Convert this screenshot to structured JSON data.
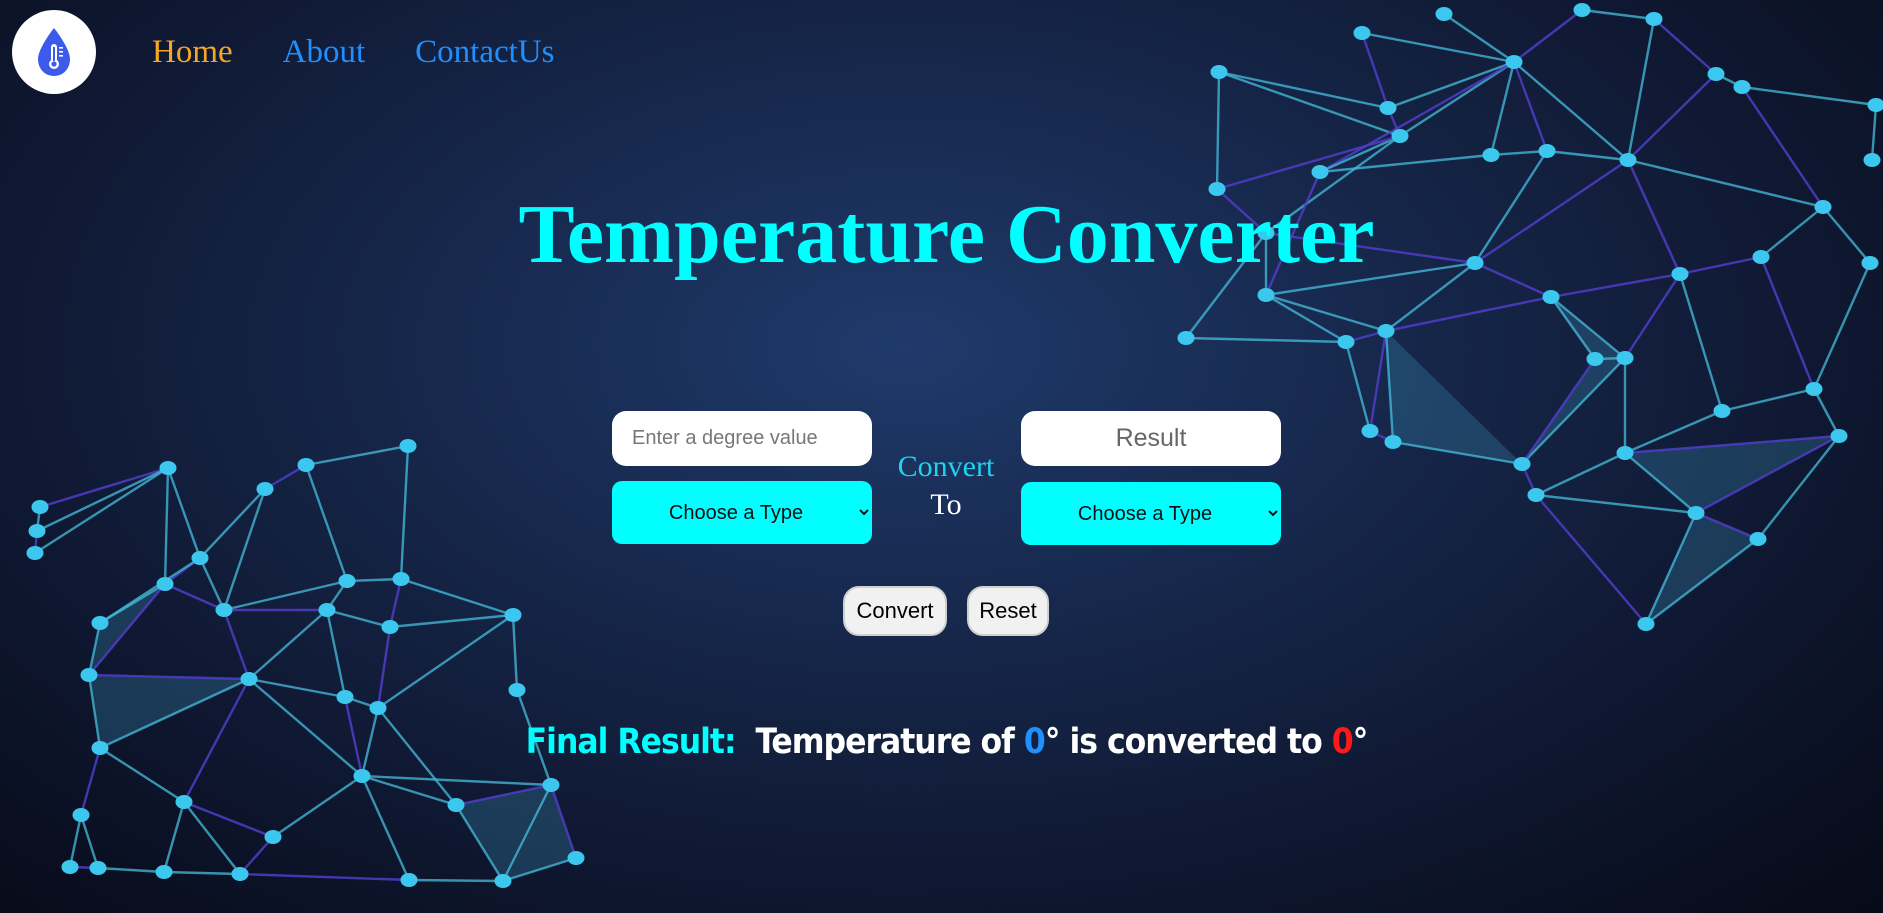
{
  "nav": {
    "links": [
      {
        "label": "Home",
        "active": true
      },
      {
        "label": "About",
        "active": false
      },
      {
        "label": "ContactUs",
        "active": false
      }
    ]
  },
  "title": "Temperature Converter",
  "converter": {
    "input_placeholder": "Enter a degree value",
    "input_value": "",
    "result_placeholder": "Result",
    "result_value": "",
    "from_select_value": "Choose a Type",
    "to_select_value": "Choose a Type",
    "convert_label_line1": "Convert",
    "convert_label_line2": "To"
  },
  "buttons": {
    "convert": "Convert",
    "reset": "Reset"
  },
  "final_result": {
    "label": "Final Result:",
    "prefix": "Temperature of",
    "input_value": "0",
    "degree": "°",
    "middle": "is converted to",
    "output_value": "0"
  },
  "colors": {
    "accent": "#00ffff",
    "nav_active": "#f5a623",
    "nav_link": "#1f8fff",
    "input_value_color": "#1e90ff",
    "output_value_color": "#ff1a1a"
  },
  "icons": {
    "logo": "thermometer-drop-icon",
    "select_arrow": "chevron-down-icon"
  }
}
